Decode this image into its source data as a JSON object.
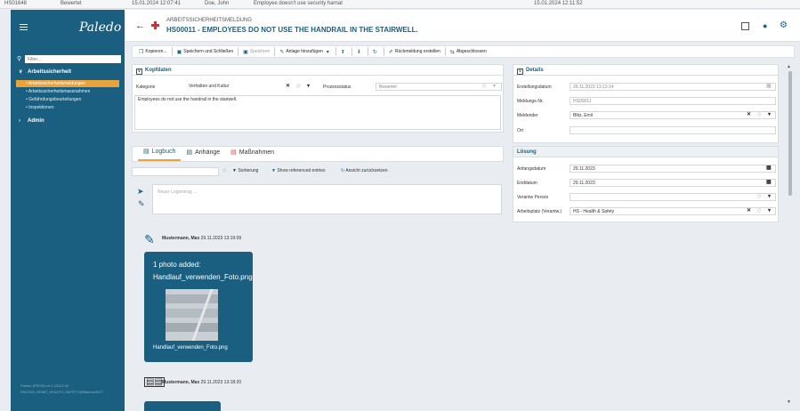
{
  "bg_strip": {
    "id": "HS01648",
    "status": "Bewertet",
    "date": "15.01.2024 12:07:41",
    "user": "Doe, John",
    "desc": "Employee doesn't use security harnat",
    "date2": "15.01.2024 12:11:52"
  },
  "sidebar": {
    "logo": "Paledo",
    "filter_placeholder": "Filter...",
    "group1": "Arbeitssicherheit",
    "items": [
      "Arbeitssicherheitsmeldungen",
      "Arbeitssicherheitsmassnahmen",
      "Gefährdungsbeurteilungen",
      "Inspektionen"
    ],
    "group2": "Admin",
    "footer1": "Paledo (PROD) v4.0.23122.54",
    "footer2": "PALEDO_DEMO_HEALTH_SAFETY@itbarbox2017"
  },
  "header": {
    "type": "ARBEITSSICHERHEITSMELDUNG",
    "title": "HS00011 - EMPLOYEES DO NOT USE THE HANDRAIL IN THE STAIRWELL."
  },
  "toolbar": {
    "copy": "Kopieren...",
    "save_close": "Speichern und Schließen",
    "save": "Speichern",
    "attach": "Anlage hinzufügen",
    "feedback": "Rückmeldung erstellen",
    "closed": "Abgeschlossen"
  },
  "kopfdaten": {
    "title": "Kopfdaten",
    "kategorie_label": "Kategorie",
    "kategorie_value": "Verhalten und Kultur",
    "prozess_label": "Prozessstatus",
    "prozess_value": "Bewertet",
    "description": "Employees do not use the handrail in the stairwell."
  },
  "details": {
    "title": "Details",
    "erstellung_label": "Erstellungsdatum",
    "erstellung_value": "29.11.2023 13:13:14",
    "meldungs_label": "Meldungs-Nr.",
    "meldungs_value": "HS00011",
    "meldender_label": "Meldender",
    "meldender_value": "Blitz, Emil",
    "ort_label": "Ort"
  },
  "loesung": {
    "title": "Lösung",
    "anfang_label": "Anfangsdatum",
    "anfang_value": "29.11.2023",
    "end_label": "Enddatum",
    "end_value": "29.11.2023",
    "person_label": "Verantw Person",
    "platz_label": "Arbeitsplatz (Verantw.)",
    "platz_value": "HS - Health & Safety"
  },
  "tabs": [
    "Logbuch",
    "Anhänge",
    "Maßnahmen"
  ],
  "logbuch": {
    "sort": "Sortierung",
    "show_refs": "Show referenced entries",
    "reset": "Ansicht zurücksetzen",
    "new_entry_placeholder": "Neuer Logeintrag ...",
    "entry1_author": "Mustermann, Max",
    "entry1_date": "29.11.2023 13:19:09",
    "entry1_title": "1 photo added:",
    "entry1_file": "Handlauf_verwenden_Foto.png",
    "entry1_caption": "Handlauf_verwenden_Foto.png",
    "entry2_author": "Mustermann, Max",
    "entry2_date": "29.11.2023 13:18:20"
  }
}
